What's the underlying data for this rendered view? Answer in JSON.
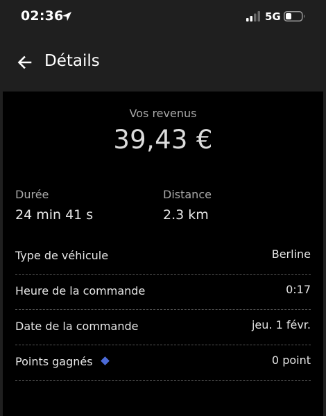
{
  "status_bar": {
    "time": "02:36",
    "network": "5G",
    "icons": [
      "location-arrow-icon",
      "signal-icon",
      "battery-icon"
    ]
  },
  "header": {
    "back_icon": "arrow-left-icon",
    "title": "Détails"
  },
  "earnings": {
    "label": "Vos revenus",
    "value": "39,43 €"
  },
  "stats": {
    "duration_label": "Durée",
    "duration_value": "24 min 41 s",
    "distance_label": "Distance",
    "distance_value": "2.3 km"
  },
  "details": [
    {
      "label": "Type de véhicule",
      "value": "Berline"
    },
    {
      "label": "Heure de la commande",
      "value": "0:17"
    },
    {
      "label": "Date de la commande",
      "value": "jeu. 1 févr."
    },
    {
      "label": "Points gagnés",
      "value": "0 point"
    }
  ],
  "colors": {
    "background": "#1f1f1f",
    "card": "#000000",
    "points_diamond": "#4c6bd8",
    "muted_text": "#a9a9a9"
  }
}
